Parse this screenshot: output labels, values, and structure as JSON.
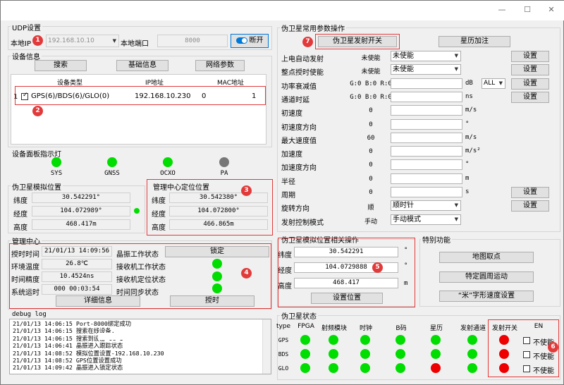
{
  "window": {
    "min": "—",
    "max": "☐",
    "close": "✕"
  },
  "udp": {
    "title": "UDP设置",
    "local_ip_label": "本地IP",
    "local_ip": "192.168.10.10",
    "port_label": "本地端口",
    "port": "8000",
    "disconnect": "断开"
  },
  "device": {
    "title": "设备信息",
    "search": "搜索",
    "basic_info": "基础信息",
    "net_params": "网络参数",
    "col_type": "设备类型",
    "col_ip": "IP地址",
    "col_mac": "MAC地址",
    "row": {
      "index": "1",
      "type": "GPS(6)/BDS(6)/GLO(0)",
      "ip": "192.168.10.230",
      "mac_a": "0",
      "mac_b": "1"
    }
  },
  "indicators": {
    "title": "设备面板指示灯",
    "items": [
      {
        "label": "SYS"
      },
      {
        "label": "GNSS"
      },
      {
        "label": "OCXO"
      },
      {
        "label": "PA"
      }
    ]
  },
  "sim_pos": {
    "title": "伪卫星模拟位置",
    "lat_label": "纬度",
    "lat": "30.542291°",
    "lon_label": "经度",
    "lon": "104.072989°",
    "alt_label": "高度",
    "alt": "468.417m"
  },
  "mgmt_pos": {
    "title": "管理中心定位位置",
    "lat_label": "纬度",
    "lat": "30.542380°",
    "lon_label": "经度",
    "lon": "104.072800°",
    "alt_label": "高度",
    "alt": "466.865m"
  },
  "mgmt": {
    "title": "管理中心",
    "time_label": "授时时间",
    "time": "21/01/13 14:09:56",
    "temp_label": "环境温度",
    "temp": "26.8℃",
    "acc_label": "时间精度",
    "acc": "10.4524ns",
    "run_label": "系统运时",
    "run": "000 00:03:54",
    "osc_label": "晶振工作状态",
    "osc_btn": "锁定",
    "rx_work": "接收机工作状态",
    "rx_pos": "接收机定位状态",
    "sync": "时间同步状态",
    "detail": "详细信息",
    "timing": "授时"
  },
  "debug": {
    "title": "debug log",
    "lines": [
      "21/01/13 14:06:15 Port-8000绑定成功",
      "21/01/13 14:06:15 搜索在线设备.",
      "21/01/13 14:06:15 搜索到设备-0C                    1",
      "21/01/13 14:06:41 晶振进入跟踪状态",
      "21/01/13 14:08:52 模拟位置设置-192.168.10.230",
      "21/01/13 14:08:52 GPS位置设置成功",
      "21/01/13 14:09:42 晶振进入锁定状态"
    ]
  },
  "params": {
    "title": "伪卫星常用参数操作",
    "tx_switch": "伪卫星发射开关",
    "ephem": "星历加注",
    "set": "设置",
    "rows": [
      {
        "label": "上电自动发射",
        "value": "未使能",
        "select": "未使能"
      },
      {
        "label": "整点授时使能",
        "value": "未使能",
        "select": "未使能"
      },
      {
        "label": "功率衰减值",
        "value": "G:0  B:0  R:0",
        "unit": "dB",
        "select": "ALL"
      },
      {
        "label": "通道时延",
        "value": "G:0  B:0  R:0",
        "unit": "ns"
      },
      {
        "label": "初速度",
        "value": "0",
        "unit": "m/s"
      },
      {
        "label": "初速度方向",
        "value": "0",
        "unit": "°"
      },
      {
        "label": "最大速度值",
        "value": "60",
        "unit": "m/s"
      },
      {
        "label": "加速度",
        "value": "0",
        "unit": "m/s²"
      },
      {
        "label": "加速度方向",
        "value": "0",
        "unit": "°"
      },
      {
        "label": "半径",
        "value": "0",
        "unit": "m"
      },
      {
        "label": "周期",
        "value": "0",
        "unit": "s"
      },
      {
        "label": "旋转方向",
        "value": "顺",
        "select": "顺时针"
      },
      {
        "label": "发射控制模式",
        "value": "手动",
        "select": "手动模式"
      }
    ]
  },
  "sim_ops": {
    "title": "伪卫星模拟位置相关操作",
    "lat_label": "纬度",
    "lat": "30.542291",
    "lon_label": "经度",
    "lon": "104.0729888",
    "alt_label": "高度",
    "alt": "468.417",
    "unit_deg": "°",
    "unit_m": "m",
    "set_pos": "设置位置"
  },
  "special": {
    "title": "特别功能",
    "map": "地图取点",
    "circle": "特定圆周运动",
    "mi": "“米”字形速度设置"
  },
  "status": {
    "title": "伪卫星状态",
    "cols": [
      "type",
      "FPGA",
      "射频模块",
      "时钟",
      "B码",
      "星历",
      "发射通道",
      "发射开关",
      "EN"
    ],
    "rows": [
      {
        "type": "GPS",
        "en": "不使能"
      },
      {
        "type": "BDS",
        "en": "不使能"
      },
      {
        "type": "GLO",
        "en": "不使能"
      }
    ]
  },
  "badges": [
    "1",
    "2",
    "3",
    "4",
    "5",
    "6",
    "7"
  ],
  "colors": {
    "green": "#00dd00",
    "red": "#ee0000",
    "gray": "#777777",
    "highlight": "#e23a3a"
  }
}
